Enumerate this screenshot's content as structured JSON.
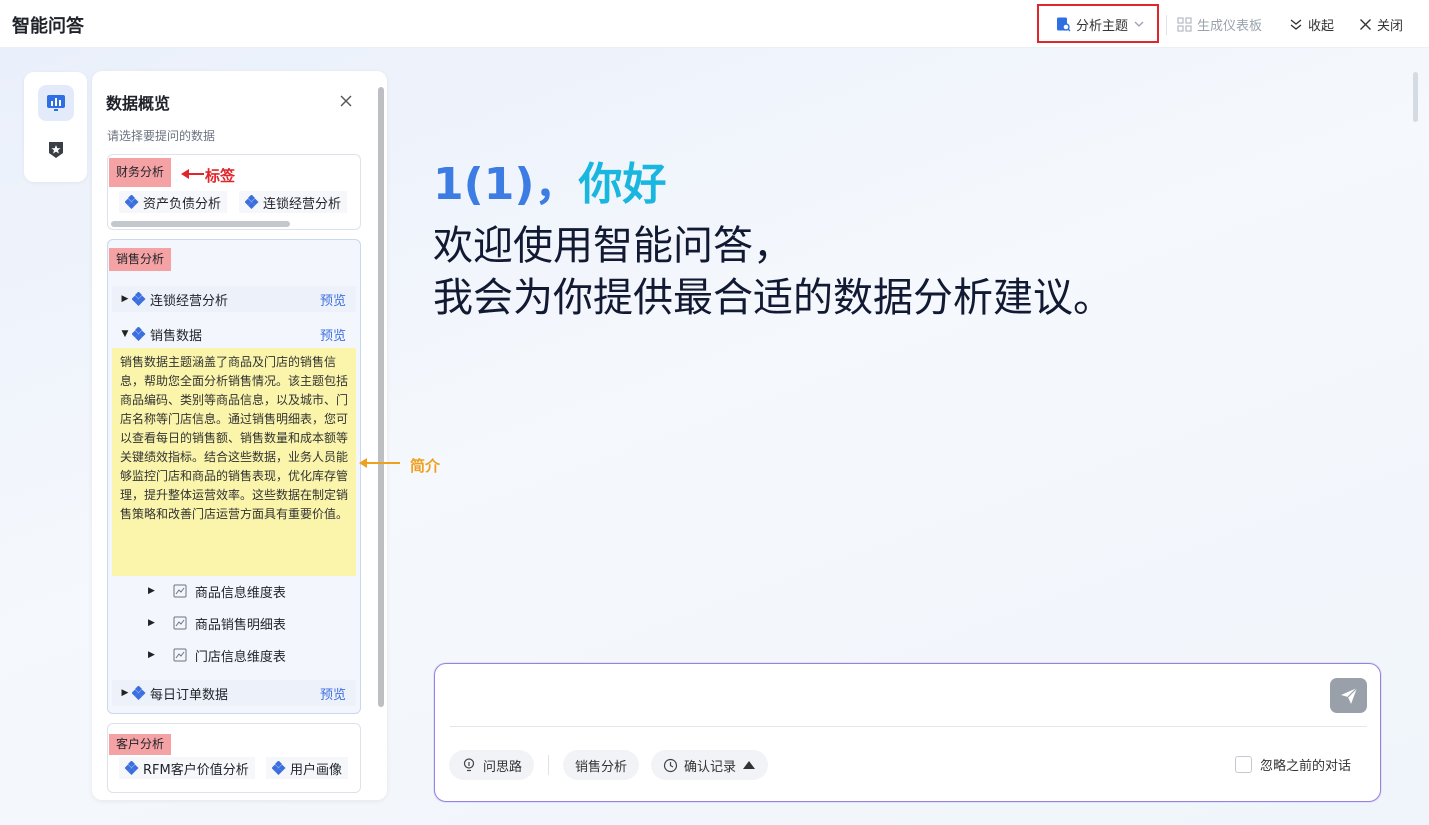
{
  "header": {
    "title": "智能问答",
    "analysis_topic_label": "分析主题",
    "generate_dashboard_label": "生成仪表板",
    "collapse_label": "收起",
    "close_label": "关闭"
  },
  "panel": {
    "title": "数据概览",
    "subtitle": "请选择要提问的数据",
    "cards": {
      "finance": {
        "tag": "财务分析",
        "chips": [
          "资产负债分析",
          "连锁经营分析"
        ]
      },
      "sales": {
        "tag": "销售分析",
        "items": [
          {
            "label": "连锁经营分析",
            "preview": "预览"
          },
          {
            "label": "销售数据",
            "preview": "预览"
          },
          {
            "label": "每日订单数据",
            "preview": "预览"
          }
        ],
        "description": "销售数据主题涵盖了商品及门店的销售信息，帮助您全面分析销售情况。该主题包括商品编码、类别等商品信息，以及城市、门店名称等门店信息。通过销售明细表，您可以查看每日的销售额、销售数量和成本额等关键绩效指标。结合这些数据，业务人员能够监控门店和商品的销售表现，优化库存管理，提升整体运营效率。这些数据在制定销售策略和改善门店运营方面具有重要价值。",
        "tables": [
          "商品信息维度表",
          "商品销售明细表",
          "门店信息维度表"
        ]
      },
      "customer": {
        "tag": "客户分析",
        "chips": [
          "RFM客户价值分析",
          "用户画像"
        ]
      }
    }
  },
  "annotations": {
    "tag_note": "标签",
    "desc_note": "简介"
  },
  "greeting": {
    "name": "1(1)，",
    "hello": "你好",
    "line1": "欢迎使用智能问答，",
    "line2": "我会为你提供最合适的数据分析建议。"
  },
  "input": {
    "value": "",
    "think_label": "问思路",
    "topic_label": "销售分析",
    "history_label": "确认记录",
    "ignore_label": "忽略之前的对话"
  },
  "colors": {
    "tag_bg": "#f4a2a4",
    "desc_bg": "#faf5ab",
    "highlight_border": "#e0252b",
    "note_red": "#e0252b",
    "note_orange": "#f0a020",
    "link_blue": "#3f6fe0"
  }
}
